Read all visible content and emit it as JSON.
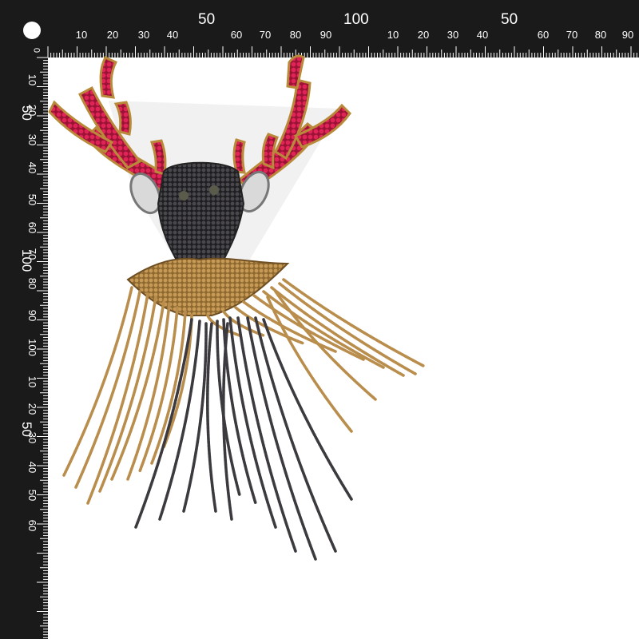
{
  "colors": {
    "ruler": "#1a1a1a",
    "ruler_marks": "#ffffff",
    "antler": "#d81b4a",
    "antler_edge": "#b88a3a",
    "head": "#2b2b2e",
    "gold_chain": "#b98d4c",
    "dark_chain": "#3c3a3e",
    "eye_stone": "#d9d9d9",
    "background": "#ffffff"
  },
  "ruler": {
    "top_major": [
      "50",
      "100",
      "50"
    ],
    "top_minor": [
      "10",
      "20",
      "30",
      "40",
      "60",
      "70",
      "80",
      "90",
      "10",
      "20",
      "30",
      "40",
      "60",
      "70",
      "80",
      "90"
    ],
    "top_zero": "0",
    "left_minor": [
      "10",
      "20",
      "30",
      "40",
      "50",
      "60",
      "70",
      "80",
      "90",
      "100",
      "10",
      "20",
      "30",
      "40",
      "50",
      "60"
    ],
    "left_major": [
      "50",
      "100",
      "50"
    ]
  },
  "image": {
    "subject": "deer-head-applique"
  }
}
